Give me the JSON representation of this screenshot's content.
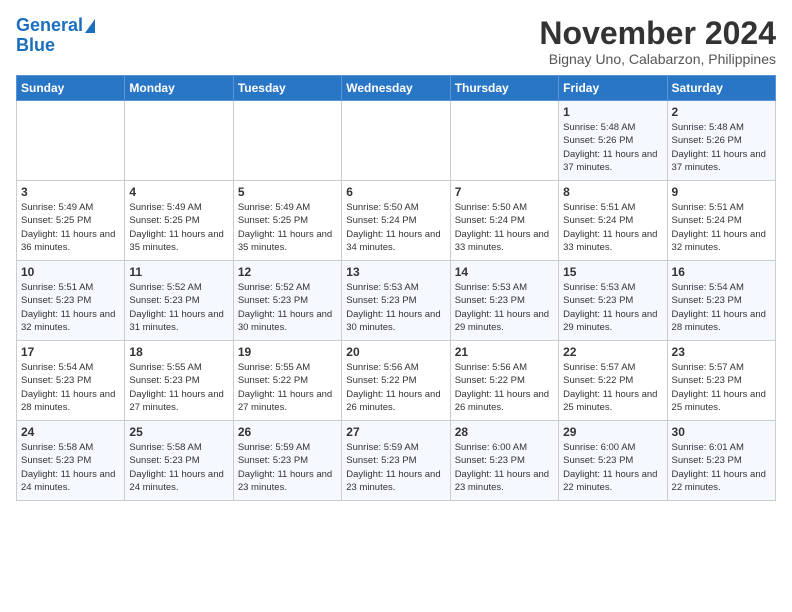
{
  "header": {
    "logo_line1": "General",
    "logo_line2": "Blue",
    "title": "November 2024",
    "subtitle": "Bignay Uno, Calabarzon, Philippines"
  },
  "days_of_week": [
    "Sunday",
    "Monday",
    "Tuesday",
    "Wednesday",
    "Thursday",
    "Friday",
    "Saturday"
  ],
  "weeks": [
    [
      {
        "day": "",
        "info": ""
      },
      {
        "day": "",
        "info": ""
      },
      {
        "day": "",
        "info": ""
      },
      {
        "day": "",
        "info": ""
      },
      {
        "day": "",
        "info": ""
      },
      {
        "day": "1",
        "info": "Sunrise: 5:48 AM\nSunset: 5:26 PM\nDaylight: 11 hours and 37 minutes."
      },
      {
        "day": "2",
        "info": "Sunrise: 5:48 AM\nSunset: 5:26 PM\nDaylight: 11 hours and 37 minutes."
      }
    ],
    [
      {
        "day": "3",
        "info": "Sunrise: 5:49 AM\nSunset: 5:25 PM\nDaylight: 11 hours and 36 minutes."
      },
      {
        "day": "4",
        "info": "Sunrise: 5:49 AM\nSunset: 5:25 PM\nDaylight: 11 hours and 35 minutes."
      },
      {
        "day": "5",
        "info": "Sunrise: 5:49 AM\nSunset: 5:25 PM\nDaylight: 11 hours and 35 minutes."
      },
      {
        "day": "6",
        "info": "Sunrise: 5:50 AM\nSunset: 5:24 PM\nDaylight: 11 hours and 34 minutes."
      },
      {
        "day": "7",
        "info": "Sunrise: 5:50 AM\nSunset: 5:24 PM\nDaylight: 11 hours and 33 minutes."
      },
      {
        "day": "8",
        "info": "Sunrise: 5:51 AM\nSunset: 5:24 PM\nDaylight: 11 hours and 33 minutes."
      },
      {
        "day": "9",
        "info": "Sunrise: 5:51 AM\nSunset: 5:24 PM\nDaylight: 11 hours and 32 minutes."
      }
    ],
    [
      {
        "day": "10",
        "info": "Sunrise: 5:51 AM\nSunset: 5:23 PM\nDaylight: 11 hours and 32 minutes."
      },
      {
        "day": "11",
        "info": "Sunrise: 5:52 AM\nSunset: 5:23 PM\nDaylight: 11 hours and 31 minutes."
      },
      {
        "day": "12",
        "info": "Sunrise: 5:52 AM\nSunset: 5:23 PM\nDaylight: 11 hours and 30 minutes."
      },
      {
        "day": "13",
        "info": "Sunrise: 5:53 AM\nSunset: 5:23 PM\nDaylight: 11 hours and 30 minutes."
      },
      {
        "day": "14",
        "info": "Sunrise: 5:53 AM\nSunset: 5:23 PM\nDaylight: 11 hours and 29 minutes."
      },
      {
        "day": "15",
        "info": "Sunrise: 5:53 AM\nSunset: 5:23 PM\nDaylight: 11 hours and 29 minutes."
      },
      {
        "day": "16",
        "info": "Sunrise: 5:54 AM\nSunset: 5:23 PM\nDaylight: 11 hours and 28 minutes."
      }
    ],
    [
      {
        "day": "17",
        "info": "Sunrise: 5:54 AM\nSunset: 5:23 PM\nDaylight: 11 hours and 28 minutes."
      },
      {
        "day": "18",
        "info": "Sunrise: 5:55 AM\nSunset: 5:23 PM\nDaylight: 11 hours and 27 minutes."
      },
      {
        "day": "19",
        "info": "Sunrise: 5:55 AM\nSunset: 5:22 PM\nDaylight: 11 hours and 27 minutes."
      },
      {
        "day": "20",
        "info": "Sunrise: 5:56 AM\nSunset: 5:22 PM\nDaylight: 11 hours and 26 minutes."
      },
      {
        "day": "21",
        "info": "Sunrise: 5:56 AM\nSunset: 5:22 PM\nDaylight: 11 hours and 26 minutes."
      },
      {
        "day": "22",
        "info": "Sunrise: 5:57 AM\nSunset: 5:22 PM\nDaylight: 11 hours and 25 minutes."
      },
      {
        "day": "23",
        "info": "Sunrise: 5:57 AM\nSunset: 5:23 PM\nDaylight: 11 hours and 25 minutes."
      }
    ],
    [
      {
        "day": "24",
        "info": "Sunrise: 5:58 AM\nSunset: 5:23 PM\nDaylight: 11 hours and 24 minutes."
      },
      {
        "day": "25",
        "info": "Sunrise: 5:58 AM\nSunset: 5:23 PM\nDaylight: 11 hours and 24 minutes."
      },
      {
        "day": "26",
        "info": "Sunrise: 5:59 AM\nSunset: 5:23 PM\nDaylight: 11 hours and 23 minutes."
      },
      {
        "day": "27",
        "info": "Sunrise: 5:59 AM\nSunset: 5:23 PM\nDaylight: 11 hours and 23 minutes."
      },
      {
        "day": "28",
        "info": "Sunrise: 6:00 AM\nSunset: 5:23 PM\nDaylight: 11 hours and 23 minutes."
      },
      {
        "day": "29",
        "info": "Sunrise: 6:00 AM\nSunset: 5:23 PM\nDaylight: 11 hours and 22 minutes."
      },
      {
        "day": "30",
        "info": "Sunrise: 6:01 AM\nSunset: 5:23 PM\nDaylight: 11 hours and 22 minutes."
      }
    ]
  ]
}
